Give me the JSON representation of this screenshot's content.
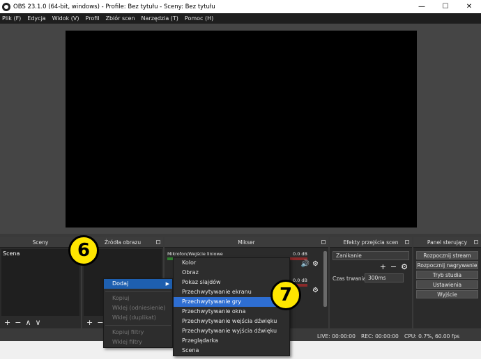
{
  "window": {
    "title": "OBS 23.1.0 (64-bit, windows) - Profile: Bez tytułu - Sceny: Bez tytułu",
    "minimize_icon": "minimize-icon",
    "maximize_icon": "maximize-icon",
    "close_icon": "close-icon"
  },
  "menubar": {
    "items": [
      "Plik (F)",
      "Edycja",
      "Widok (V)",
      "Profil",
      "Zbiór scen",
      "Narzędzia (T)",
      "Pomoc (H)"
    ]
  },
  "docks": {
    "scenes": {
      "title": "Sceny",
      "items": [
        "Scena"
      ]
    },
    "sources": {
      "title": "Źródła obrazu"
    },
    "mixer": {
      "title": "Mikser",
      "channels": [
        {
          "name": "Mikrofon/Wejście liniowe",
          "db": "0.0 dB"
        },
        {
          "name": "",
          "db": "0.0 dB"
        }
      ]
    },
    "transitions": {
      "title": "Efekty przejścia scen",
      "selected": "Zanikanie",
      "duration_label": "Czas trwania",
      "duration_value": "300ms"
    },
    "controls": {
      "title": "Panel sterujący",
      "buttons": [
        "Rozpocznij stream",
        "Rozpocznij nagrywanie",
        "Tryb studia",
        "Ustawienia",
        "Wyjście"
      ]
    }
  },
  "context_menu": {
    "items": [
      {
        "label": "Dodaj",
        "highlighted": true,
        "disabled": false
      },
      {
        "label": "Kopiuj",
        "highlighted": false,
        "disabled": true
      },
      {
        "label": "Wklej (odniesienie)",
        "highlighted": false,
        "disabled": true
      },
      {
        "label": "Wklej (duplikat)",
        "highlighted": false,
        "disabled": true
      },
      {
        "label": "Kopiuj filtry",
        "highlighted": false,
        "disabled": true
      },
      {
        "label": "Wklej filtry",
        "highlighted": false,
        "disabled": true
      }
    ]
  },
  "submenu": {
    "items": [
      "Kolor",
      "Obraz",
      "Pokaz slajdów",
      "Przechwytywanie ekranu",
      "Przechwytywanie gry",
      "Przechwytywanie okna",
      "Przechwytywanie wejścia dźwięku",
      "Przechwytywanie wyjścia dźwięku",
      "Przeglądarka",
      "Scena"
    ],
    "highlighted_index": 4
  },
  "status": {
    "live": "LIVE: 00:00:00",
    "rec": "REC: 00:00:00",
    "cpu": "CPU: 0.7%, 60.00 fps"
  },
  "callouts": [
    "6",
    "7"
  ],
  "colors": {
    "accent": "#2e6ed2",
    "callout": "#ffe600"
  }
}
